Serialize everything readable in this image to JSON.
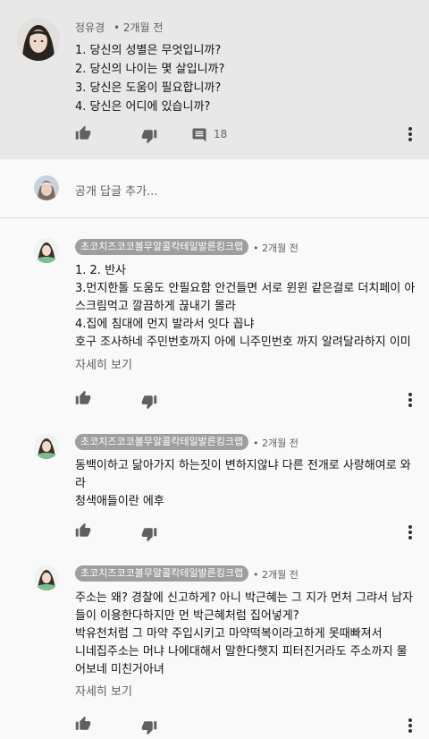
{
  "main_comment": {
    "author": "정유경",
    "time": "2개월 전",
    "lines": [
      "1. 당신의 성별은 무엇입니까?",
      "2. 당신의 나이는 몇 살입니까?",
      "3. 당신은 도움이 필요합니까?",
      "4. 당신은 어디에 있습니까?"
    ],
    "reply_count": "18"
  },
  "reply_input": {
    "placeholder": "공개 답글 추가..."
  },
  "replies": [
    {
      "author": "초코치즈코코볼무알콜칵테일발른킹크랩",
      "time": "• 2개월 전",
      "lines": [
        "1. 2. 반사",
        "3.먼지한톨 도움도 안필요함 안건들면 서로 윈윈 같은걸로 더치페이 아",
        "스크림먹고 깔끔하게 끊내기 몰라",
        "4.집에 침대에 먼지 발라서 잇다 꼽냐",
        "호구 조사하네 주민번호까지 아에 니주민번호 까지 알려달라하지 이미"
      ],
      "more": "자세히 보기"
    },
    {
      "author": "초코치즈코코볼무알콜칵테일발른킹크랩",
      "time": "• 2개월 전",
      "lines": [
        "동백이하고 닮아가지 하는짓이 변하지않냐 다른 전개로 사랑해여로 와",
        "라",
        "청색애들이란 에후"
      ]
    },
    {
      "author": "초코치즈코코볼무알콜칵테일발른킹크랩",
      "time": "• 2개월 전",
      "lines": [
        "주소는 왜? 경찰에 신고하게? 아니 박근혜는 그 지가 먼처 그랴서 남자",
        "들이 이용한다하지만 먼 박근혜처럼 집어넣게?",
        "박유천처럼 그 마약 주입시키고 마약떡복이라고하게 못때빠져서",
        "니네집주소는 머냐 나에대해서 말한다햇지 피터진거라도 주소까지 물",
        "어보네 미친거아녀"
      ],
      "more": "자세히 보기"
    }
  ]
}
